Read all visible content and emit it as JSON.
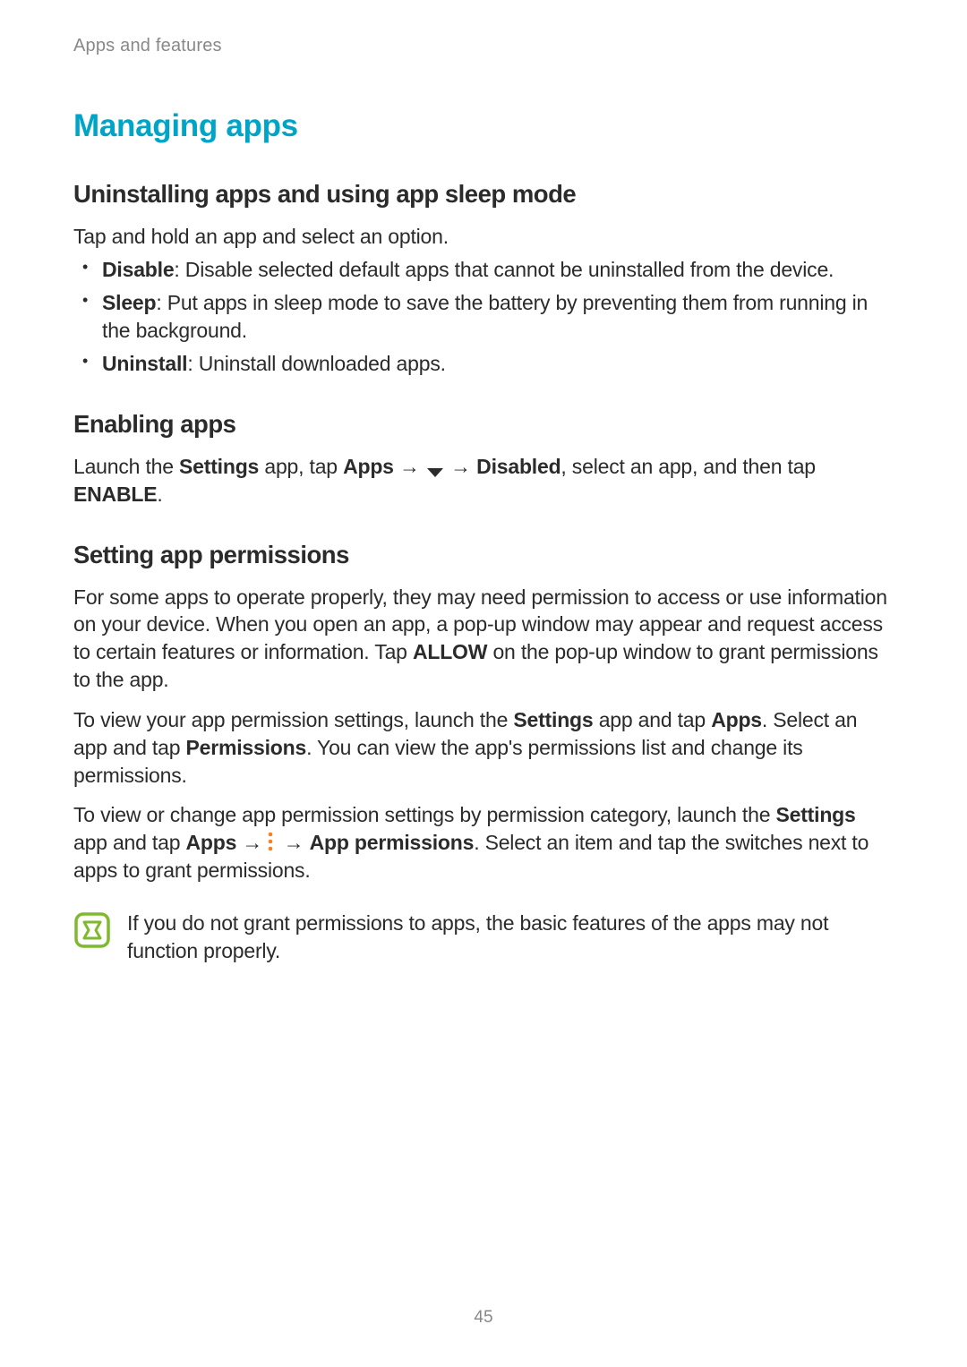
{
  "breadcrumb": "Apps and features",
  "h1": "Managing apps",
  "section1": {
    "heading": "Uninstalling apps and using app sleep mode",
    "intro": "Tap and hold an app and select an option.",
    "bullets": [
      {
        "label": "Disable",
        "desc": ": Disable selected default apps that cannot be uninstalled from the device."
      },
      {
        "label": "Sleep",
        "desc": ": Put apps in sleep mode to save the battery by preventing them from running in the background."
      },
      {
        "label": "Uninstall",
        "desc": ": Uninstall downloaded apps."
      }
    ]
  },
  "section2": {
    "heading": "Enabling apps",
    "pref": "Launch the ",
    "settings": "Settings",
    "text2": " app, tap ",
    "apps": "Apps",
    "arrow": " → ",
    "disabled": "Disabled",
    "text3": ", select an app, and then tap ",
    "enable": "ENABLE",
    "period": "."
  },
  "section3": {
    "heading": "Setting app permissions",
    "p1a": "For some apps to operate properly, they may need permission to access or use information on your device. When you open an app, a pop-up window may appear and request access to certain features or information. Tap ",
    "allow": "ALLOW",
    "p1b": " on the pop-up window to grant permissions to the app.",
    "p2a": "To view your app permission settings, launch the ",
    "settings": "Settings",
    "p2b": " app and tap ",
    "apps": "Apps",
    "p2c": ". Select an app and tap ",
    "permissions": "Permissions",
    "p2d": ". You can view the app's permissions list and change its permissions.",
    "p3a": "To view or change app permission settings by permission category, launch the ",
    "p3b": " app and tap ",
    "arrow": " → ",
    "appperm": "App permissions",
    "p3c": ". Select an item and tap the switches next to apps to grant permissions."
  },
  "note": "If you do not grant permissions to apps, the basic features of the apps may not function properly.",
  "page_number": "45"
}
